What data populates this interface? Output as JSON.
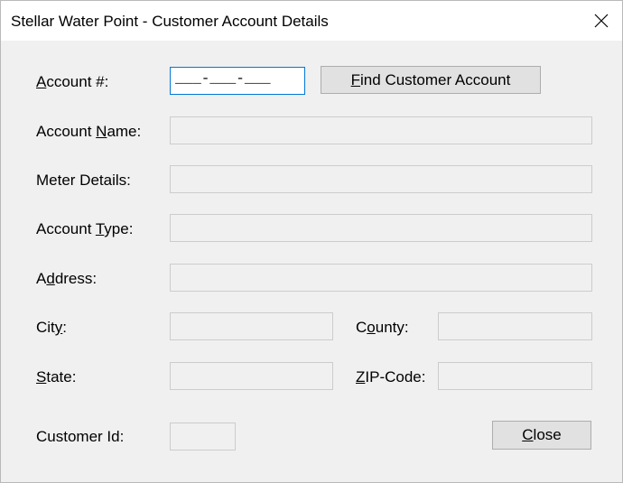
{
  "window": {
    "title": "Stellar Water Point - Customer Account Details"
  },
  "form": {
    "account_number": {
      "label_pre": "",
      "label_key": "A",
      "label_post": "ccount #:",
      "value": "___-___-___"
    },
    "account_name": {
      "label_pre": "Account ",
      "label_key": "N",
      "label_post": "ame:",
      "value": ""
    },
    "meter_details": {
      "label": "Meter Details:",
      "value": ""
    },
    "account_type": {
      "label_pre": "Account ",
      "label_key": "T",
      "label_post": "ype:",
      "value": ""
    },
    "address": {
      "label_pre": "A",
      "label_key": "d",
      "label_post": "dress:",
      "value": ""
    },
    "city": {
      "label_pre": "Cit",
      "label_key": "y",
      "label_post": ":",
      "value": ""
    },
    "county": {
      "label_pre": "C",
      "label_key": "o",
      "label_post": "unty:",
      "value": ""
    },
    "state": {
      "label_pre": "",
      "label_key": "S",
      "label_post": "tate:",
      "value": ""
    },
    "zip_code": {
      "label_pre": "",
      "label_key": "Z",
      "label_post": "IP-Code:",
      "value": ""
    },
    "customer_id": {
      "label": "Customer Id:",
      "value": ""
    }
  },
  "buttons": {
    "find": {
      "label_pre": "",
      "label_key": "F",
      "label_post": "ind Customer Account"
    },
    "close": {
      "label_pre": "",
      "label_key": "C",
      "label_post": "lose"
    }
  },
  "icons": {
    "window_close": "close-icon"
  }
}
